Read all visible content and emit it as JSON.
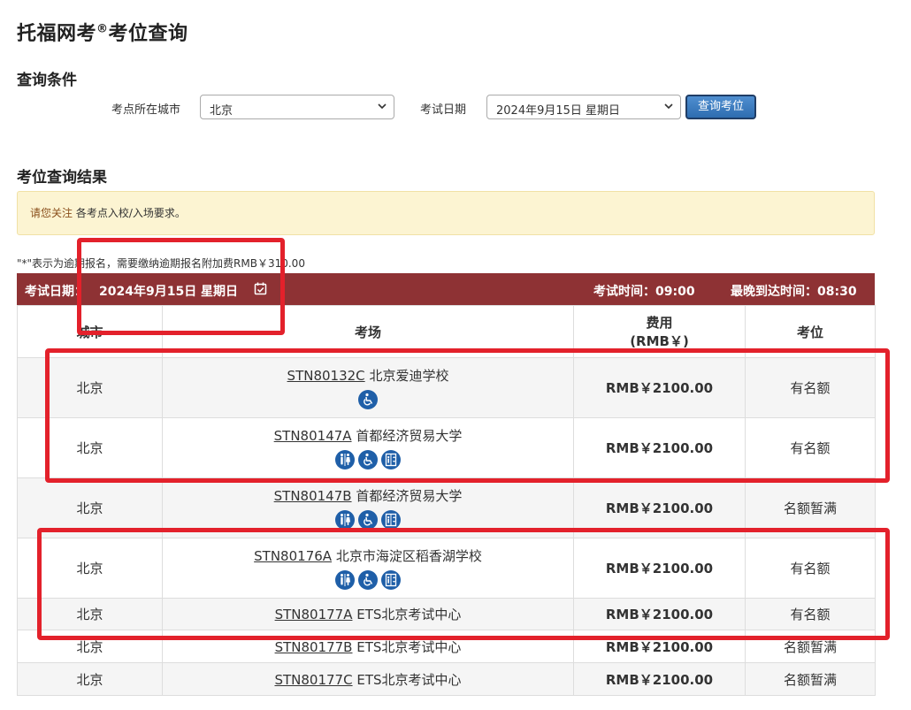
{
  "page": {
    "title": "托福网考",
    "title_sup": "®",
    "title_suffix": "考位查询"
  },
  "search": {
    "section_title": "查询条件",
    "city_label": "考点所在城市",
    "city_value": "北京",
    "date_label": "考试日期",
    "date_value": "2024年9月15日 星期日",
    "submit_label": "查询考位"
  },
  "results": {
    "section_title": "考位查询结果",
    "alert_highlight": "请您关注",
    "alert_text": " 各考点入校/入场要求。",
    "note": "\"*\"表示为逾期报名，需要缴纳逾期报名附加费RMB￥310.00",
    "header_date_label": "考试日期：",
    "header_date_value": "2024年9月15日 星期日",
    "header_time": "考试时间：09:00",
    "header_arrival": "最晚到达时间：08:30",
    "columns": {
      "city": "城市",
      "center": "考场",
      "fee_line1": "费用",
      "fee_line2": "(RMB￥)",
      "seat": "考位"
    },
    "rows": [
      {
        "city": "北京",
        "code": "STN80132C",
        "name": "北京爱迪学校",
        "fee": "RMB￥2100.00",
        "seat": "有名额",
        "icons": [
          "wheelchair-icon"
        ]
      },
      {
        "city": "北京",
        "code": "STN80147A",
        "name": "首都经济贸易大学",
        "fee": "RMB￥2100.00",
        "seat": "有名额",
        "icons": [
          "restroom-icon",
          "wheelchair-icon",
          "elevator-icon"
        ]
      },
      {
        "city": "北京",
        "code": "STN80147B",
        "name": "首都经济贸易大学",
        "fee": "RMB￥2100.00",
        "seat": "名额暂满",
        "icons": [
          "restroom-icon",
          "wheelchair-icon",
          "elevator-icon"
        ]
      },
      {
        "city": "北京",
        "code": "STN80176A",
        "name": "北京市海淀区稻香湖学校",
        "fee": "RMB￥2100.00",
        "seat": "有名额",
        "icons": [
          "restroom-icon",
          "wheelchair-icon",
          "elevator-icon"
        ]
      },
      {
        "city": "北京",
        "code": "STN80177A",
        "name": "ETS北京考试中心",
        "fee": "RMB￥2100.00",
        "seat": "有名额",
        "icons": []
      },
      {
        "city": "北京",
        "code": "STN80177B",
        "name": "ETS北京考试中心",
        "fee": "RMB￥2100.00",
        "seat": "名额暂满",
        "icons": []
      },
      {
        "city": "北京",
        "code": "STN80177C",
        "name": "ETS北京考试中心",
        "fee": "RMB￥2100.00",
        "seat": "名额暂满",
        "icons": []
      }
    ]
  },
  "colors": {
    "header_bar": "#8e3234",
    "accent_blue": "#1f5fa8",
    "annotation_red": "#e3212b",
    "alert_bg": "#fcf4d2"
  }
}
